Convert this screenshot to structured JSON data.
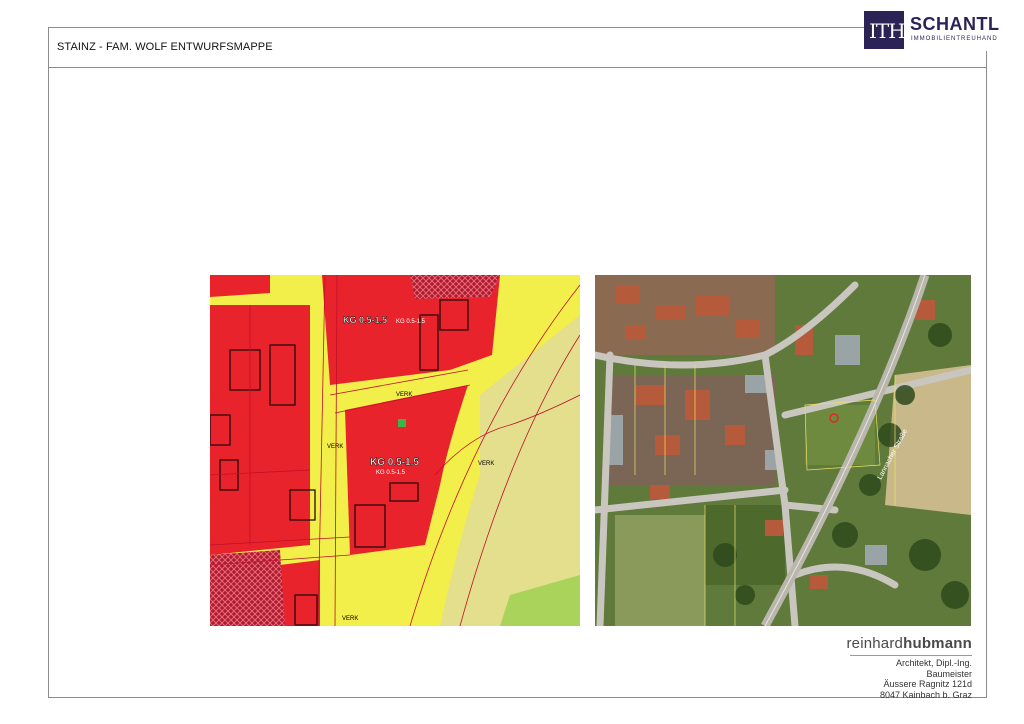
{
  "header": {
    "title": "STAINZ - FAM. WOLF ENTWURFSMAPPE"
  },
  "logo": {
    "mark": "ITH",
    "name": "SCHANTL",
    "subtitle": "IMMOBILIENTREUHAND"
  },
  "zoning_map": {
    "zone_label_top": "KG 0.5-1.5",
    "zone_label_top_small": "KG 0.5-1.5",
    "zone_label_center": "KG 0.5-1.5",
    "zone_label_center_small": "KG 0.5-1.5",
    "road_labels": [
      "VERK",
      "VERK",
      "VERK",
      "VERK"
    ]
  },
  "aerial_map": {
    "street_label": "Lannacher Straße"
  },
  "architect": {
    "name_light": "reinhard",
    "name_bold": "hubmann",
    "lines": [
      "Architekt, Dipl.-Ing.",
      "Baumeister",
      "Äussere Ragnitz 121d",
      "8047 Kainbach b. Graz"
    ]
  },
  "colors": {
    "zone_red": "#e8232b",
    "road_yellow": "#f2ee4a",
    "brand_navy": "#2b2356"
  }
}
